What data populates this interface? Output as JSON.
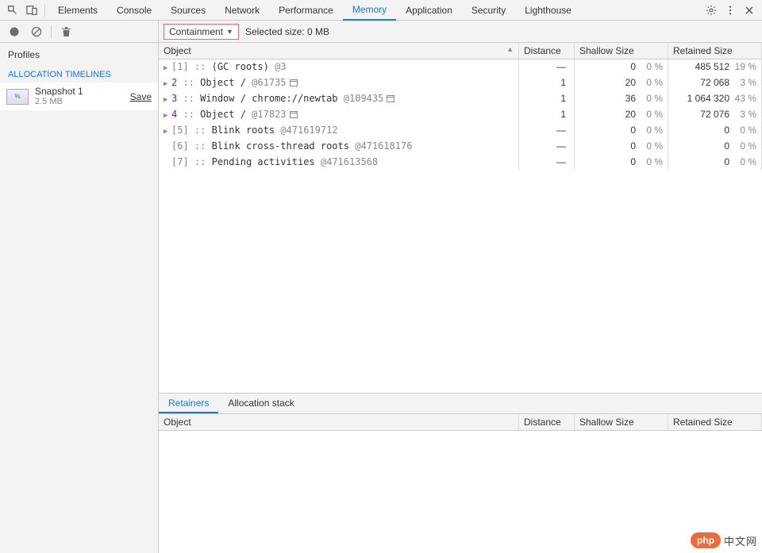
{
  "topTabs": {
    "items": [
      {
        "label": "Elements"
      },
      {
        "label": "Console"
      },
      {
        "label": "Sources"
      },
      {
        "label": "Network"
      },
      {
        "label": "Performance"
      },
      {
        "label": "Memory",
        "active": true
      },
      {
        "label": "Application"
      },
      {
        "label": "Security"
      },
      {
        "label": "Lighthouse"
      }
    ]
  },
  "toolbar": {
    "viewSelector": "Containment",
    "selectedSize": "Selected size: 0 MB"
  },
  "sidebar": {
    "profiles": "Profiles",
    "timelinesLabel": "ALLOCATION TIMELINES",
    "snapshot": {
      "title": "Snapshot 1",
      "subtitle": "2.5 MB",
      "save": "Save"
    }
  },
  "columns": {
    "object": "Object",
    "distance": "Distance",
    "shallow": "Shallow Size",
    "retained": "Retained Size"
  },
  "rows": [
    {
      "expandable": true,
      "idx": "[1]",
      "idxGrey": true,
      "name": "(GC roots)",
      "at": "@3",
      "win": false,
      "distance": "—",
      "shallowVal": "0",
      "shallowPct": "0 %",
      "retVal": "485 512",
      "retPct": "19 %"
    },
    {
      "expandable": true,
      "idx": "2",
      "idxGrey": false,
      "name": "Object /",
      "at": "@61735",
      "win": true,
      "distance": "1",
      "shallowVal": "20",
      "shallowPct": "0 %",
      "retVal": "72 068",
      "retPct": "3 %"
    },
    {
      "expandable": true,
      "idx": "3",
      "idxGrey": false,
      "name": "Window / chrome://newtab",
      "at": "@109435",
      "win": true,
      "distance": "1",
      "shallowVal": "36",
      "shallowPct": "0 %",
      "retVal": "1 064 320",
      "retPct": "43 %"
    },
    {
      "expandable": true,
      "idx": "4",
      "idxGrey": false,
      "name": "Object /",
      "at": "@17823",
      "win": true,
      "distance": "1",
      "shallowVal": "20",
      "shallowPct": "0 %",
      "retVal": "72 076",
      "retPct": "3 %"
    },
    {
      "expandable": true,
      "idx": "[5]",
      "idxGrey": true,
      "name": "Blink roots",
      "at": "@471619712",
      "win": false,
      "distance": "—",
      "shallowVal": "0",
      "shallowPct": "0 %",
      "retVal": "0",
      "retPct": "0 %"
    },
    {
      "expandable": false,
      "idx": "[6]",
      "idxGrey": true,
      "name": "Blink cross-thread roots",
      "at": "@471618176",
      "win": false,
      "distance": "—",
      "shallowVal": "0",
      "shallowPct": "0 %",
      "retVal": "0",
      "retPct": "0 %"
    },
    {
      "expandable": false,
      "idx": "[7]",
      "idxGrey": true,
      "name": "Pending activities",
      "at": "@471613568",
      "win": false,
      "distance": "—",
      "shallowVal": "0",
      "shallowPct": "0 %",
      "retVal": "0",
      "retPct": "0 %"
    }
  ],
  "bottomTabs": {
    "items": [
      {
        "label": "Retainers",
        "active": true
      },
      {
        "label": "Allocation stack"
      }
    ]
  },
  "watermark": {
    "brand": "php",
    "text": "中文网"
  }
}
